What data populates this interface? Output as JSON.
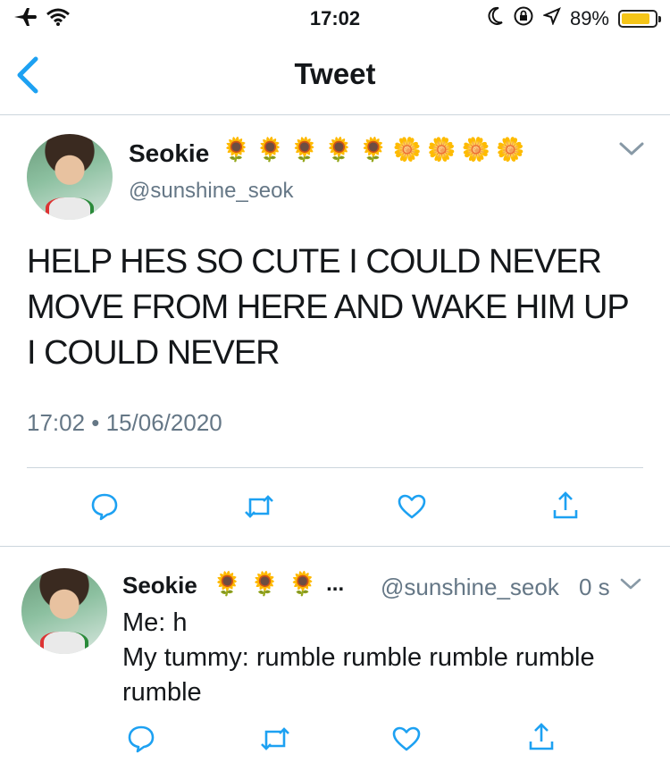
{
  "status_bar": {
    "time": "17:02",
    "battery_pct": "89%",
    "battery_level": 0.89
  },
  "nav": {
    "title": "Tweet"
  },
  "main_tweet": {
    "author_name": "Seokie",
    "name_emojis": [
      "🌻",
      "🌻",
      "🌻",
      "🌻",
      "🌻",
      "🌼",
      "🌼",
      "🌼",
      "🌼"
    ],
    "handle": "@sunshine_seok",
    "text": "HELP HES SO CUTE I COULD NEVER MOVE FROM HERE AND WAKE HIM UP I COULD NEVER",
    "timestamp": "17:02 • 15/06/2020"
  },
  "reply_tweet": {
    "author_name": "Seokie",
    "name_emojis": [
      "🌻",
      "🌻",
      "🌻"
    ],
    "ellipsis": "...",
    "handle": "@sunshine_seok",
    "age": "0 s",
    "line1": "Me: h",
    "line2": "My tummy: rumble rumble rumble rumble rumble"
  },
  "colors": {
    "accent": "#1da1f2",
    "icon_gray": "#657786",
    "divider": "#ccd6dd"
  }
}
